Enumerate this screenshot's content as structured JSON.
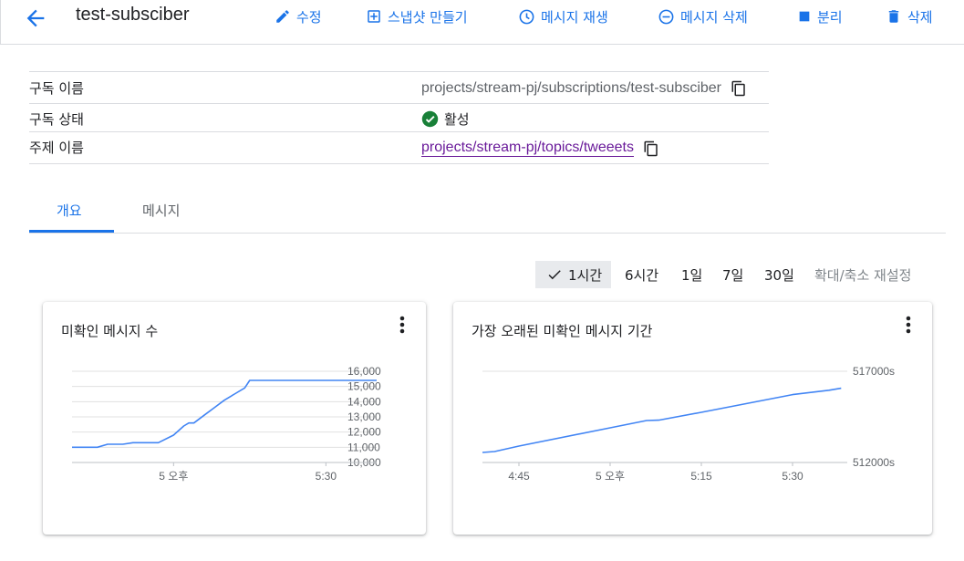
{
  "header": {
    "title": "test-subsciber",
    "actions": {
      "edit": "수정",
      "snapshot": "스냅샷 만들기",
      "replay": "메시지 재생",
      "purge": "메시지 삭제",
      "detach": "분리",
      "delete": "삭제"
    }
  },
  "details": [
    {
      "label": "구독 이름",
      "value": "projects/stream-pj/subscriptions/test-subsciber"
    },
    {
      "label": "구독 상태",
      "value": "활성"
    },
    {
      "label": "주제 이름",
      "value": "projects/stream-pj/topics/tweeets"
    }
  ],
  "tabs": [
    "개요",
    "메시지"
  ],
  "time_ranges": {
    "selected": "1시간",
    "options": [
      "6시간",
      "1일",
      "7일",
      "30일"
    ],
    "reset": "확대/축소 재설정"
  },
  "colors": {
    "accent": "#1a73e8",
    "link": "#6a1b9a",
    "active_status": "#188038",
    "series": "#4285f4"
  },
  "chart_data": [
    {
      "type": "line",
      "title": "미확인 메시지 수",
      "x_labels": [
        "5 오후",
        "5:30"
      ],
      "y_ticks": [
        "16,000",
        "15,000",
        "14,000",
        "13,000",
        "12,000",
        "11,000",
        "10,000"
      ],
      "ylim": [
        10000,
        16000
      ],
      "xlim": [
        "4:40",
        "5:40"
      ],
      "series": [
        {
          "x": [
            "4:40",
            "4:45",
            "4:47",
            "4:50",
            "4:52",
            "4:57",
            "5:00",
            "5:02",
            "5:03",
            "5:04",
            "5:06",
            "5:08",
            "5:10",
            "5:12",
            "5:14",
            "5:15",
            "5:20",
            "5:30",
            "5:40"
          ],
          "y": [
            11000,
            11000,
            11200,
            11200,
            11300,
            11300,
            11800,
            12400,
            12600,
            12600,
            13100,
            13600,
            14100,
            14500,
            14900,
            15400,
            15400,
            15400,
            15400
          ]
        }
      ],
      "grid": true,
      "legend": "none"
    },
    {
      "type": "line",
      "title": "가장 오래된 미확인 메시지 기간",
      "x_labels": [
        "4:45",
        "5 오후",
        "5:15",
        "5:30"
      ],
      "y_ticks": [
        "517000s",
        "512000s"
      ],
      "ylim": [
        512000,
        517000
      ],
      "xlim": [
        "4:39",
        "5:39"
      ],
      "series": [
        {
          "x": [
            "4:39",
            "4:41",
            "4:45",
            "5:00",
            "5:06",
            "5:08",
            "5:15",
            "5:30",
            "5:36",
            "5:38"
          ],
          "y": [
            512550,
            512600,
            512900,
            513900,
            514300,
            514320,
            514750,
            515720,
            515960,
            516070
          ]
        }
      ],
      "grid": true,
      "legend": "none"
    }
  ]
}
